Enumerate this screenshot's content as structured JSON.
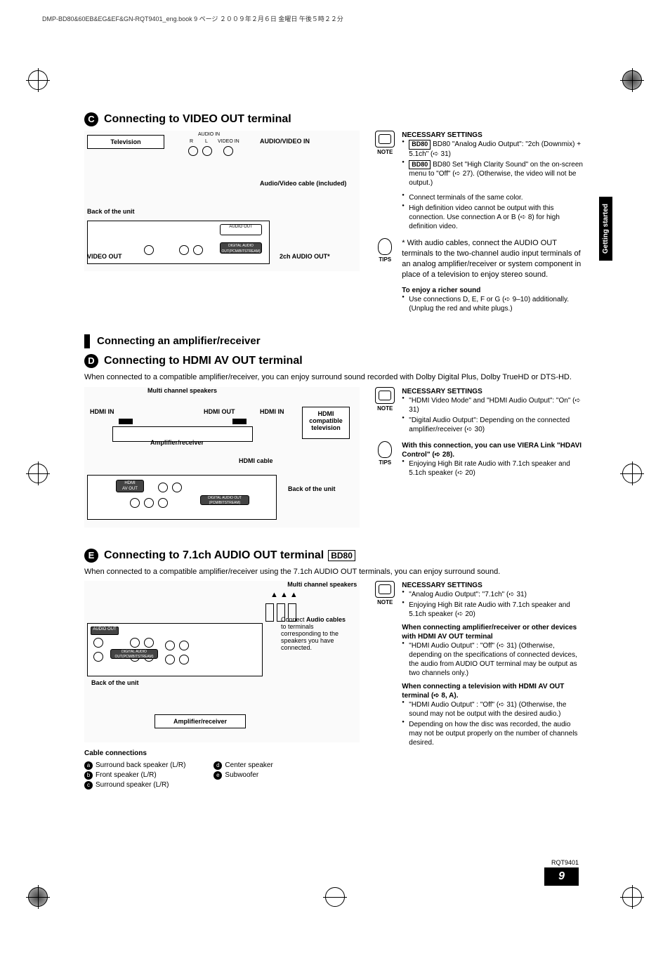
{
  "header_line": "DMP-BD80&60EB&EG&EF&GN-RQT9401_eng.book  9 ページ  ２００９年２月６日  金曜日  午後５時２２分",
  "side_tab": "Getting started",
  "section_c": {
    "letter": "C",
    "title": "Connecting to VIDEO OUT terminal",
    "labels": {
      "television": "Television",
      "audio_in": "AUDIO IN",
      "r": "R",
      "l": "L",
      "video_in": "VIDEO IN",
      "av_in": "AUDIO/VIDEO IN",
      "av_cable": "Audio/Video cable (included)",
      "back": "Back of the unit",
      "video_out": "VIDEO OUT",
      "audio_out": "2ch AUDIO OUT*"
    },
    "note_heading": "NECESSARY SETTINGS",
    "note_items": [
      "BD80 \"Analog Audio Output\": \"2ch (Downmix) + 5.1ch\" (➪ 31)",
      "BD80 Set \"High Clarity Sound\" on the on-screen menu to \"Off\" (➪ 27). (Otherwise, the video will not be output.)",
      "Connect terminals of the same color.",
      "High definition video cannot be output with this connection. Use connection A or B (➪ 8) for high definition video."
    ],
    "tips": [
      "* With audio cables, connect the AUDIO OUT terminals to the two-channel audio input terminals of an analog amplifier/receiver or system component in place of a television to enjoy stereo sound."
    ],
    "richer_heading": "To enjoy a richer sound",
    "richer_items": [
      "Use connections D, E, F or G (➪ 9–10) additionally. (Unplug the red and white plugs.)"
    ]
  },
  "amp_section_title": "Connecting an amplifier/receiver",
  "section_d": {
    "letter": "D",
    "title": "Connecting to HDMI AV OUT terminal",
    "intro": "When connected to a compatible amplifier/receiver, you can enjoy surround sound recorded with Dolby Digital Plus, Dolby TrueHD or DTS-HD.",
    "labels": {
      "multi_speakers": "Multi channel speakers",
      "hdmi_in1": "HDMI IN",
      "hdmi_out": "HDMI OUT",
      "hdmi_in2": "HDMI IN",
      "amp": "Amplifier/receiver",
      "tv": "HDMI compatible television",
      "hdmi_cable": "HDMI cable",
      "back": "Back of the unit"
    },
    "note_heading": "NECESSARY SETTINGS",
    "note_items": [
      "\"HDMI Video Mode\" and \"HDMI Audio Output\": \"On\" (➪ 31)",
      "\"Digital Audio Output\": Depending on the connected amplifier/receiver (➪ 30)"
    ],
    "tips_heading": "With this connection, you can use VIERA Link \"HDAVI Control\" (➪ 28).",
    "tips_items": [
      "Enjoying High Bit rate Audio with 7.1ch speaker and 5.1ch speaker (➪ 20)"
    ]
  },
  "section_e": {
    "letter": "E",
    "title": "Connecting to 7.1ch AUDIO OUT terminal",
    "badge": "BD80",
    "intro": "When connected to a compatible amplifier/receiver using the 7.1ch AUDIO OUT terminals, you can enjoy surround sound.",
    "labels": {
      "multi_speakers": "Multi channel speakers",
      "connect_audio": "Connect Audio cables to terminals corresponding to the speakers you have connected.",
      "back": "Back of the unit",
      "amp": "Amplifier/receiver"
    },
    "legend_heading": "Cable connections",
    "legend": {
      "a": "Surround back speaker (L/R)",
      "b": "Front speaker (L/R)",
      "c": "Surround speaker (L/R)",
      "d": "Center speaker",
      "e": "Subwoofer"
    },
    "note_heading": "NECESSARY SETTINGS",
    "note_items": [
      "\"Analog Audio Output\": \"7.1ch\" (➪ 31)",
      "Enjoying High Bit rate Audio with 7.1ch speaker and 5.1ch speaker (➪ 20)"
    ],
    "cond1_heading": "When connecting amplifier/receiver or other devices with HDMI AV OUT terminal",
    "cond1_items": [
      "\"HDMI Audio Output\" : \"Off\" (➪ 31) (Otherwise, depending on the specifications of connected devices, the audio from AUDIO OUT terminal may be output as two channels only.)"
    ],
    "cond2_heading": "When connecting a television with HDMI AV OUT terminal (➪ 8, A).",
    "cond2_items": [
      "\"HDMI Audio Output\" : \"Off\" (➪ 31) (Otherwise, the sound may not be output with the desired audio.)",
      "Depending on how the disc was recorded, the audio may not be output properly on the number of channels desired."
    ]
  },
  "note_label": "NOTE",
  "tips_label": "TIPS",
  "footer_code": "RQT9401",
  "page_number": "9"
}
